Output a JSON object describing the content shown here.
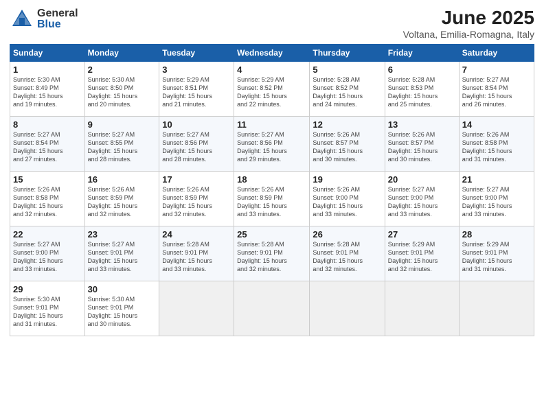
{
  "header": {
    "logo_general": "General",
    "logo_blue": "Blue",
    "title": "June 2025",
    "subtitle": "Voltana, Emilia-Romagna, Italy"
  },
  "calendar": {
    "days_of_week": [
      "Sunday",
      "Monday",
      "Tuesday",
      "Wednesday",
      "Thursday",
      "Friday",
      "Saturday"
    ],
    "weeks": [
      [
        {
          "day": "",
          "empty": true
        },
        {
          "day": "",
          "empty": true
        },
        {
          "day": "",
          "empty": true
        },
        {
          "day": "",
          "empty": true
        },
        {
          "day": "",
          "empty": true
        },
        {
          "day": "",
          "empty": true
        },
        {
          "day": "",
          "empty": true
        }
      ]
    ],
    "cells": {
      "week1": [
        {
          "num": "",
          "detail": "",
          "empty": true
        },
        {
          "num": "",
          "detail": "",
          "empty": true
        },
        {
          "num": "",
          "detail": "",
          "empty": true
        },
        {
          "num": "",
          "detail": "",
          "empty": true
        },
        {
          "num": "",
          "detail": "",
          "empty": true
        },
        {
          "num": "",
          "detail": "",
          "empty": true
        },
        {
          "num": "",
          "detail": "",
          "empty": true
        }
      ]
    }
  },
  "weeks": [
    {
      "id": 1,
      "days": [
        {
          "num": "1",
          "detail": "Sunrise: 5:30 AM\nSunset: 8:49 PM\nDaylight: 15 hours\nand 19 minutes.",
          "empty": false
        },
        {
          "num": "2",
          "detail": "Sunrise: 5:30 AM\nSunset: 8:50 PM\nDaylight: 15 hours\nand 20 minutes.",
          "empty": false
        },
        {
          "num": "3",
          "detail": "Sunrise: 5:29 AM\nSunset: 8:51 PM\nDaylight: 15 hours\nand 21 minutes.",
          "empty": false
        },
        {
          "num": "4",
          "detail": "Sunrise: 5:29 AM\nSunset: 8:52 PM\nDaylight: 15 hours\nand 22 minutes.",
          "empty": false
        },
        {
          "num": "5",
          "detail": "Sunrise: 5:28 AM\nSunset: 8:52 PM\nDaylight: 15 hours\nand 24 minutes.",
          "empty": false
        },
        {
          "num": "6",
          "detail": "Sunrise: 5:28 AM\nSunset: 8:53 PM\nDaylight: 15 hours\nand 25 minutes.",
          "empty": false
        },
        {
          "num": "7",
          "detail": "Sunrise: 5:27 AM\nSunset: 8:54 PM\nDaylight: 15 hours\nand 26 minutes.",
          "empty": false
        }
      ]
    },
    {
      "id": 2,
      "days": [
        {
          "num": "8",
          "detail": "Sunrise: 5:27 AM\nSunset: 8:54 PM\nDaylight: 15 hours\nand 27 minutes.",
          "empty": false
        },
        {
          "num": "9",
          "detail": "Sunrise: 5:27 AM\nSunset: 8:55 PM\nDaylight: 15 hours\nand 28 minutes.",
          "empty": false
        },
        {
          "num": "10",
          "detail": "Sunrise: 5:27 AM\nSunset: 8:56 PM\nDaylight: 15 hours\nand 28 minutes.",
          "empty": false
        },
        {
          "num": "11",
          "detail": "Sunrise: 5:27 AM\nSunset: 8:56 PM\nDaylight: 15 hours\nand 29 minutes.",
          "empty": false
        },
        {
          "num": "12",
          "detail": "Sunrise: 5:26 AM\nSunset: 8:57 PM\nDaylight: 15 hours\nand 30 minutes.",
          "empty": false
        },
        {
          "num": "13",
          "detail": "Sunrise: 5:26 AM\nSunset: 8:57 PM\nDaylight: 15 hours\nand 30 minutes.",
          "empty": false
        },
        {
          "num": "14",
          "detail": "Sunrise: 5:26 AM\nSunset: 8:58 PM\nDaylight: 15 hours\nand 31 minutes.",
          "empty": false
        }
      ]
    },
    {
      "id": 3,
      "days": [
        {
          "num": "15",
          "detail": "Sunrise: 5:26 AM\nSunset: 8:58 PM\nDaylight: 15 hours\nand 32 minutes.",
          "empty": false
        },
        {
          "num": "16",
          "detail": "Sunrise: 5:26 AM\nSunset: 8:59 PM\nDaylight: 15 hours\nand 32 minutes.",
          "empty": false
        },
        {
          "num": "17",
          "detail": "Sunrise: 5:26 AM\nSunset: 8:59 PM\nDaylight: 15 hours\nand 32 minutes.",
          "empty": false
        },
        {
          "num": "18",
          "detail": "Sunrise: 5:26 AM\nSunset: 8:59 PM\nDaylight: 15 hours\nand 33 minutes.",
          "empty": false
        },
        {
          "num": "19",
          "detail": "Sunrise: 5:26 AM\nSunset: 9:00 PM\nDaylight: 15 hours\nand 33 minutes.",
          "empty": false
        },
        {
          "num": "20",
          "detail": "Sunrise: 5:27 AM\nSunset: 9:00 PM\nDaylight: 15 hours\nand 33 minutes.",
          "empty": false
        },
        {
          "num": "21",
          "detail": "Sunrise: 5:27 AM\nSunset: 9:00 PM\nDaylight: 15 hours\nand 33 minutes.",
          "empty": false
        }
      ]
    },
    {
      "id": 4,
      "days": [
        {
          "num": "22",
          "detail": "Sunrise: 5:27 AM\nSunset: 9:00 PM\nDaylight: 15 hours\nand 33 minutes.",
          "empty": false
        },
        {
          "num": "23",
          "detail": "Sunrise: 5:27 AM\nSunset: 9:01 PM\nDaylight: 15 hours\nand 33 minutes.",
          "empty": false
        },
        {
          "num": "24",
          "detail": "Sunrise: 5:28 AM\nSunset: 9:01 PM\nDaylight: 15 hours\nand 33 minutes.",
          "empty": false
        },
        {
          "num": "25",
          "detail": "Sunrise: 5:28 AM\nSunset: 9:01 PM\nDaylight: 15 hours\nand 32 minutes.",
          "empty": false
        },
        {
          "num": "26",
          "detail": "Sunrise: 5:28 AM\nSunset: 9:01 PM\nDaylight: 15 hours\nand 32 minutes.",
          "empty": false
        },
        {
          "num": "27",
          "detail": "Sunrise: 5:29 AM\nSunset: 9:01 PM\nDaylight: 15 hours\nand 32 minutes.",
          "empty": false
        },
        {
          "num": "28",
          "detail": "Sunrise: 5:29 AM\nSunset: 9:01 PM\nDaylight: 15 hours\nand 31 minutes.",
          "empty": false
        }
      ]
    },
    {
      "id": 5,
      "days": [
        {
          "num": "29",
          "detail": "Sunrise: 5:30 AM\nSunset: 9:01 PM\nDaylight: 15 hours\nand 31 minutes.",
          "empty": false
        },
        {
          "num": "30",
          "detail": "Sunrise: 5:30 AM\nSunset: 9:01 PM\nDaylight: 15 hours\nand 30 minutes.",
          "empty": false
        },
        {
          "num": "",
          "detail": "",
          "empty": true
        },
        {
          "num": "",
          "detail": "",
          "empty": true
        },
        {
          "num": "",
          "detail": "",
          "empty": true
        },
        {
          "num": "",
          "detail": "",
          "empty": true
        },
        {
          "num": "",
          "detail": "",
          "empty": true
        }
      ]
    }
  ],
  "dow": [
    "Sunday",
    "Monday",
    "Tuesday",
    "Wednesday",
    "Thursday",
    "Friday",
    "Saturday"
  ]
}
